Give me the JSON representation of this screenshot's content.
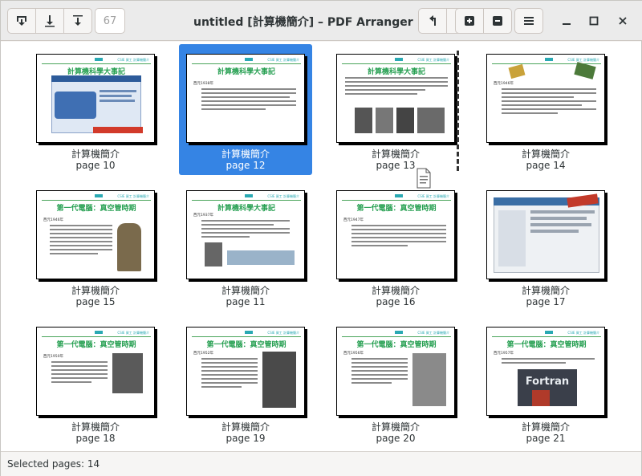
{
  "window": {
    "title": "untitled [計算機簡介] – PDF Arranger",
    "zoom_value": "67"
  },
  "toolbar": {
    "left_icons": [
      "menu-save-icon",
      "download-icon",
      "import-icon"
    ],
    "right_icons": [
      "rotate-left-icon",
      "rotate-right-icon",
      "zoom-in-icon",
      "zoom-out-icon",
      "hamburger-menu-icon"
    ],
    "window_controls": [
      "minimize-icon",
      "maximize-icon",
      "close-icon"
    ]
  },
  "pages": [
    {
      "doc": "計算機簡介",
      "label": "page 10",
      "title": "計算機科學大事記",
      "selected": false,
      "kind": "screenshot-red"
    },
    {
      "doc": "計算機簡介",
      "label": "page 12",
      "title": "計算機科學大事記",
      "selected": true,
      "kind": "text",
      "bullet": "西元1938年"
    },
    {
      "doc": "計算機簡介",
      "label": "page 13",
      "title": "計算機科學大事記",
      "selected": false,
      "kind": "photos"
    },
    {
      "doc": "計算機簡介",
      "label": "page 14",
      "title": "",
      "selected": false,
      "kind": "text-icons",
      "bullet": "西元1946年"
    },
    {
      "doc": "計算機簡介",
      "label": "page 15",
      "title": "第一代電腦：真空管時期",
      "selected": false,
      "kind": "tube",
      "bullet": "西元1946年"
    },
    {
      "doc": "計算機簡介",
      "label": "page 11",
      "title": "計算機科學大事記",
      "selected": false,
      "kind": "turing",
      "bullet": "西元1937年"
    },
    {
      "doc": "計算機簡介",
      "label": "page 16",
      "title": "第一代電腦：真空管時期",
      "selected": false,
      "kind": "text",
      "bullet": "西元1947年"
    },
    {
      "doc": "計算機簡介",
      "label": "page 17",
      "title": "",
      "selected": false,
      "kind": "screenshot-web"
    },
    {
      "doc": "計算機簡介",
      "label": "page 18",
      "title": "第一代電腦：真空管時期",
      "selected": false,
      "kind": "portrait",
      "bullet": "西元1950年"
    },
    {
      "doc": "計算機簡介",
      "label": "page 19",
      "title": "第一代電腦：真空管時期",
      "selected": false,
      "kind": "portrait-right",
      "bullet": "西元1952年"
    },
    {
      "doc": "計算機簡介",
      "label": "page 20",
      "title": "第一代電腦：真空管時期",
      "selected": false,
      "kind": "portrait-right",
      "bullet": "西元1956年"
    },
    {
      "doc": "計算機簡介",
      "label": "page 21",
      "title": "第一代電腦：真空管時期",
      "selected": false,
      "kind": "fortran",
      "bullet": "西元1957年",
      "image_text": "Fortran"
    }
  ],
  "status": {
    "text": "Selected pages: 14"
  }
}
